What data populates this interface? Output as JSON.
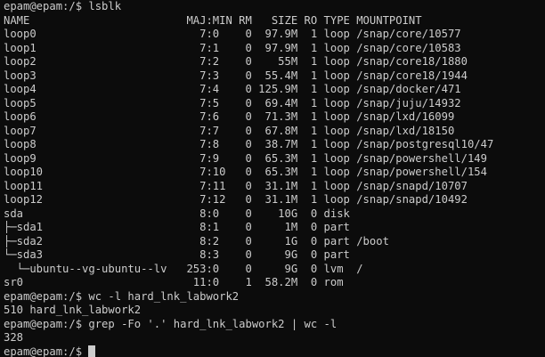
{
  "terminal": {
    "lines": [
      "epam@epam:/$ lsblk",
      "NAME                        MAJ:MIN RM   SIZE RO TYPE MOUNTPOINT",
      "loop0                         7:0    0  97.9M  1 loop /snap/core/10577",
      "loop1                         7:1    0  97.9M  1 loop /snap/core/10583",
      "loop2                         7:2    0    55M  1 loop /snap/core18/1880",
      "loop3                         7:3    0  55.4M  1 loop /snap/core18/1944",
      "loop4                         7:4    0 125.9M  1 loop /snap/docker/471",
      "loop5                         7:5    0  69.4M  1 loop /snap/juju/14932",
      "loop6                         7:6    0  71.3M  1 loop /snap/lxd/16099",
      "loop7                         7:7    0  67.8M  1 loop /snap/lxd/18150",
      "loop8                         7:8    0  38.7M  1 loop /snap/postgresql10/47",
      "loop9                         7:9    0  65.3M  1 loop /snap/powershell/149",
      "loop10                        7:10   0  65.3M  1 loop /snap/powershell/154",
      "loop11                        7:11   0  31.1M  1 loop /snap/snapd/10707",
      "loop12                        7:12   0  31.1M  1 loop /snap/snapd/10492",
      "sda                           8:0    0    10G  0 disk",
      "├─sda1                        8:1    0     1M  0 part",
      "├─sda2                        8:2    0     1G  0 part /boot",
      "└─sda3                        8:3    0     9G  0 part",
      "  └─ubuntu--vg-ubuntu--lv   253:0    0     9G  0 lvm  /",
      "sr0                          11:0    1  58.2M  0 rom",
      "epam@epam:/$ wc -l hard_lnk_labwork2",
      "510 hard_lnk_labwork2",
      "epam@epam:/$ grep -Fo '.' hard_lnk_labwork2 | wc -l",
      "328"
    ],
    "prompt": "epam@epam:/$ "
  }
}
